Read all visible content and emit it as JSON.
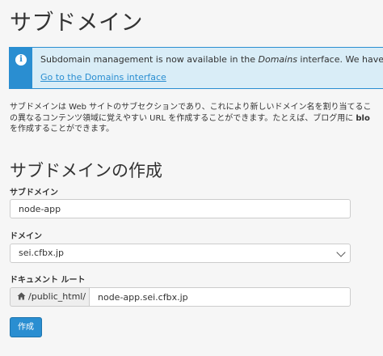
{
  "page": {
    "title": "サブドメイン"
  },
  "alert": {
    "message_pre": "Subdomain management is now available in the ",
    "message_em": "Domains",
    "message_post": " interface. We have deprecate",
    "link": "Go to the Domains interface"
  },
  "description": {
    "line1": "サブドメインは Web サイトのサブセクションであり、これにより新しいドメイン名を割り当てるこ",
    "line2_pre": "の異なるコンテンツ領域に覚えやすい URL を作成することができます。たとえば、ブログ用に ",
    "line2_bold": "blo",
    "line3": "を作成することができます。"
  },
  "form": {
    "section_title": "サブドメインの作成",
    "subdomain_label": "サブドメイン",
    "subdomain_value": "node-app",
    "domain_label": "ドメイン",
    "domain_value": "sei.cfbx.jp",
    "docroot_label": "ドキュメント ルート",
    "docroot_prefix": "/public_html/",
    "docroot_value": "node-app.sei.cfbx.jp",
    "submit_label": "作成"
  },
  "icons": {
    "alert": "info-icon",
    "docroot_prefix": "home-icon",
    "select": "chevron-down-icon"
  },
  "colors": {
    "accent": "#2a8ed1",
    "alert_bg": "#d9edf7"
  }
}
